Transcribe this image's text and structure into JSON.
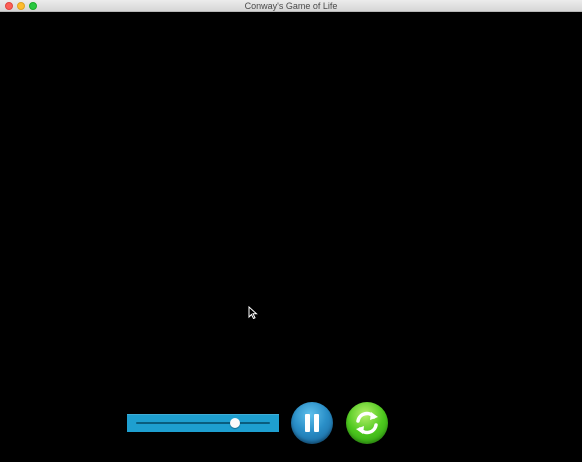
{
  "window": {
    "title": "Conway's Game of Life"
  },
  "controls": {
    "speed_slider": {
      "value_fraction": 0.74
    },
    "pause_button": {
      "icon": "pause-icon"
    },
    "reset_button": {
      "icon": "refresh-icon"
    }
  },
  "colors": {
    "board_background": "#000000",
    "slider_background": "#1e9fd0",
    "pause_button": "#2a8fc8",
    "reset_button": "#4dc81e"
  }
}
